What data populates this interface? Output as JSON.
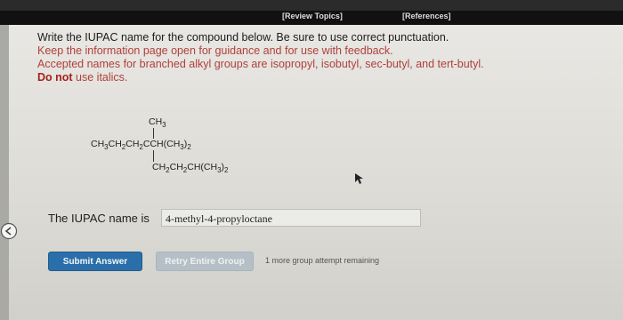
{
  "nav": {
    "review_topics": "[Review Topics]",
    "references": "[References]"
  },
  "instructions": {
    "line1": "Write the IUPAC name for the compound below. Be sure to use correct punctuation.",
    "line2": "Keep the information page open for guidance and for use with feedback.",
    "line3": "Accepted names for branched alkyl groups are isopropyl, isobutyl, sec-butyl, and tert-butyl.",
    "line4_bold": "Do not",
    "line4_rest": " use italics."
  },
  "structure": {
    "top_group": "CH",
    "top_sub": "3",
    "main_chain": "CH3CH2CH2CCH(CH3)2",
    "side_chain": "CH2CH2CH(CH3)2"
  },
  "answer": {
    "label": "The IUPAC name is",
    "value": "4-methyl-4-propyloctane"
  },
  "buttons": {
    "submit": "Submit Answer",
    "retry": "Retry Entire Group"
  },
  "attempts_text": "1 more group attempt remaining",
  "colors": {
    "instruction_red": "#b0403a",
    "submit_blue": "#2a6fa9",
    "retry_gray": "#b5bfc7"
  },
  "icons": {
    "left_circle": "back-arrow-icon",
    "cursor": "mouse-pointer-icon"
  }
}
